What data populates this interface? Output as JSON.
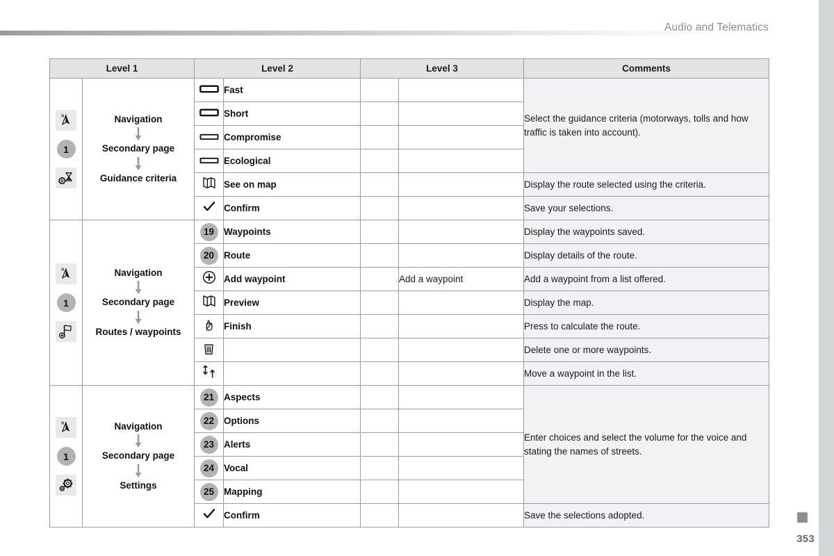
{
  "header": {
    "title": "Audio and Telematics"
  },
  "footer": {
    "page_number": "353"
  },
  "table": {
    "columns": [
      "Level 1",
      "Level 2",
      "Level 3",
      "Comments"
    ],
    "sections": [
      {
        "id": "guidance-criteria",
        "icons": [
          "navigation-compass-icon",
          "number-1-circle",
          "gear-hourglass-icon"
        ],
        "badge_number": "1",
        "flow": [
          "Navigation",
          "Secondary page",
          "Guidance criteria"
        ],
        "rows": [
          {
            "icon": "bar-thick-icon",
            "badge": "",
            "level2": "Fast",
            "level3": "",
            "comment": ""
          },
          {
            "icon": "bar-thick-icon",
            "badge": "",
            "level2": "Short",
            "level3": "",
            "comment": ""
          },
          {
            "icon": "bar-thin-icon",
            "badge": "",
            "level2": "Compromise",
            "level3": "",
            "comment": ""
          },
          {
            "icon": "bar-thin-icon",
            "badge": "",
            "level2": "Ecological",
            "level3": "",
            "comment": ""
          },
          {
            "icon": "folded-map-icon",
            "badge": "",
            "level2": "See on map",
            "level3": "",
            "comment": "Display the route selected using the criteria."
          },
          {
            "icon": "checkmark-icon",
            "badge": "",
            "level2": "Confirm",
            "level3": "",
            "comment": "Save your selections."
          }
        ],
        "merged_comment": "Select the guidance criteria (motorways, tolls and how traffic is taken into account).",
        "merged_comment_span": 4
      },
      {
        "id": "routes-waypoints",
        "icons": [
          "navigation-compass-icon",
          "number-1-circle",
          "flag-add-icon"
        ],
        "badge_number": "1",
        "flow": [
          "Navigation",
          "Secondary page",
          "Routes / waypoints"
        ],
        "rows": [
          {
            "icon": "number-badge",
            "badge": "19",
            "level2": "Waypoints",
            "level3": "",
            "comment": "Display the waypoints saved."
          },
          {
            "icon": "number-badge",
            "badge": "20",
            "level2": "Route",
            "level3": "",
            "comment": "Display details of the route."
          },
          {
            "icon": "plus-circle-icon",
            "badge": "",
            "level2": "Add waypoint",
            "level3": "Add a waypoint",
            "comment": "Add a waypoint from a list offered."
          },
          {
            "icon": "folded-map-icon",
            "badge": "",
            "level2": "Preview",
            "level3": "",
            "comment": "Display the map."
          },
          {
            "icon": "pointing-hand-icon",
            "badge": "",
            "level2": "Finish",
            "level3": "",
            "comment": "Press to calculate the route."
          },
          {
            "icon": "trash-bin-icon",
            "badge": "",
            "level2": "",
            "level3": "",
            "comment": "Delete one or more waypoints."
          },
          {
            "icon": "move-updown-icon",
            "badge": "",
            "level2": "",
            "level3": "",
            "comment": "Move a waypoint in the list."
          }
        ]
      },
      {
        "id": "settings",
        "icons": [
          "navigation-compass-icon",
          "number-1-circle",
          "gears-icon"
        ],
        "badge_number": "1",
        "flow": [
          "Navigation",
          "Secondary page",
          "Settings"
        ],
        "rows": [
          {
            "icon": "number-badge",
            "badge": "21",
            "level2": "Aspects",
            "level3": "",
            "comment": ""
          },
          {
            "icon": "number-badge",
            "badge": "22",
            "level2": "Options",
            "level3": "",
            "comment": ""
          },
          {
            "icon": "number-badge",
            "badge": "23",
            "level2": "Alerts",
            "level3": "",
            "comment": ""
          },
          {
            "icon": "number-badge",
            "badge": "24",
            "level2": "Vocal",
            "level3": "",
            "comment": ""
          },
          {
            "icon": "number-badge",
            "badge": "25",
            "level2": "Mapping",
            "level3": "",
            "comment": ""
          },
          {
            "icon": "checkmark-icon",
            "badge": "",
            "level2": "Confirm",
            "level3": "",
            "comment": "Save the selections adopted."
          }
        ],
        "merged_comment": "Enter choices and select the volume for the voice and stating the names of streets.",
        "merged_comment_span": 5
      }
    ]
  },
  "colors": {
    "header_row": "#e3e3e3",
    "comment_bg": "#f1f2f4",
    "border": "#9a9da1",
    "badge_gray": "#b3b3b3",
    "icon_tile": "#e9e9e9",
    "right_strip": "#d4d6d8",
    "title_gray": "#8d8d8d"
  }
}
